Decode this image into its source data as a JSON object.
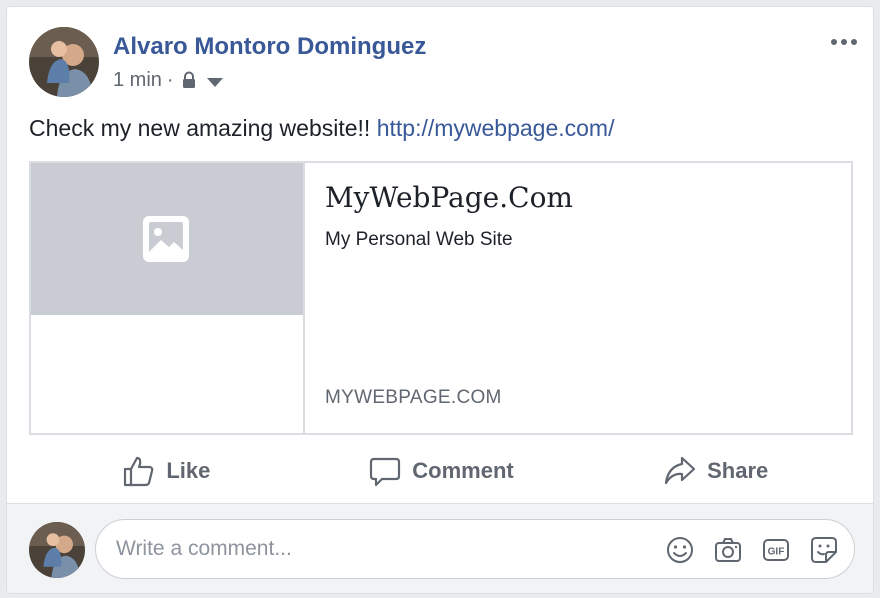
{
  "post": {
    "author": "Alvaro Montoro Dominguez",
    "time": "1 min",
    "separator": "·",
    "text": "Check my new amazing website!!",
    "link": "http://mywebpage.com/",
    "avatar_icon": "profile-photo"
  },
  "menu": {
    "icon": "more-options-icon"
  },
  "link_preview": {
    "title": "MyWebPage.Com",
    "description": "My Personal Web Site",
    "domain": "MYWEBPAGE.COM",
    "thumbnail_icon": "image-placeholder-icon"
  },
  "actions": {
    "like": "Like",
    "comment": "Comment",
    "share": "Share"
  },
  "comment": {
    "placeholder": "Write a comment...",
    "icons": [
      "emoji-icon",
      "camera-icon",
      "gif-icon",
      "sticker-icon"
    ]
  },
  "colors": {
    "link": "#385898",
    "secondary_text": "#606770",
    "thumbnail_bg": "#c9ccd3",
    "page_bg": "#e9ebee"
  }
}
